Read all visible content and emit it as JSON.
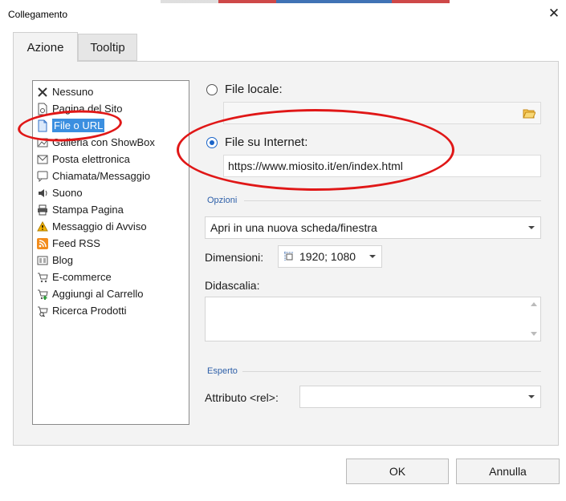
{
  "window": {
    "title": "Collegamento"
  },
  "tabs": [
    {
      "label": "Azione",
      "active": true
    },
    {
      "label": "Tooltip",
      "active": false
    }
  ],
  "sidebar": {
    "items": [
      {
        "label": "Nessuno",
        "icon": "x-icon"
      },
      {
        "label": "Pagina del Sito",
        "icon": "page-link-icon"
      },
      {
        "label": "File o URL",
        "icon": "file-icon",
        "selected": true
      },
      {
        "label": "Galleria con ShowBox",
        "icon": "gallery-icon"
      },
      {
        "label": "Posta elettronica",
        "icon": "email-icon"
      },
      {
        "label": "Chiamata/Messaggio",
        "icon": "phone-icon"
      },
      {
        "label": "Suono",
        "icon": "speaker-icon"
      },
      {
        "label": "Stampa Pagina",
        "icon": "printer-icon"
      },
      {
        "label": "Messaggio di Avviso",
        "icon": "warning-icon"
      },
      {
        "label": "Feed RSS",
        "icon": "rss-icon"
      },
      {
        "label": "Blog",
        "icon": "blog-icon"
      },
      {
        "label": "E-commerce",
        "icon": "cart-icon"
      },
      {
        "label": "Aggiungi al Carrello",
        "icon": "cart-add-icon"
      },
      {
        "label": "Ricerca Prodotti",
        "icon": "cart-search-icon"
      }
    ]
  },
  "main": {
    "file_locale": {
      "label": "File locale:",
      "checked": false,
      "value": ""
    },
    "file_internet": {
      "label": "File su Internet:",
      "checked": true,
      "value": "https://www.miosito.it/en/index.html"
    },
    "opzioni": {
      "section_label": "Opzioni",
      "open_mode": "Apri in una nuova scheda/finestra",
      "dimensioni_label": "Dimensioni:",
      "dimensioni_value": "1920; 1080",
      "didascalia_label": "Didascalia:",
      "didascalia_value": ""
    },
    "esperto": {
      "section_label": "Esperto",
      "rel_label": "Attributo <rel>:",
      "rel_value": ""
    }
  },
  "footer": {
    "ok_label": "OK",
    "cancel_label": "Annulla"
  },
  "colors": {
    "selection": "#3b8fe0",
    "annotation": "#e01717",
    "section_label": "#2d5fa8"
  }
}
